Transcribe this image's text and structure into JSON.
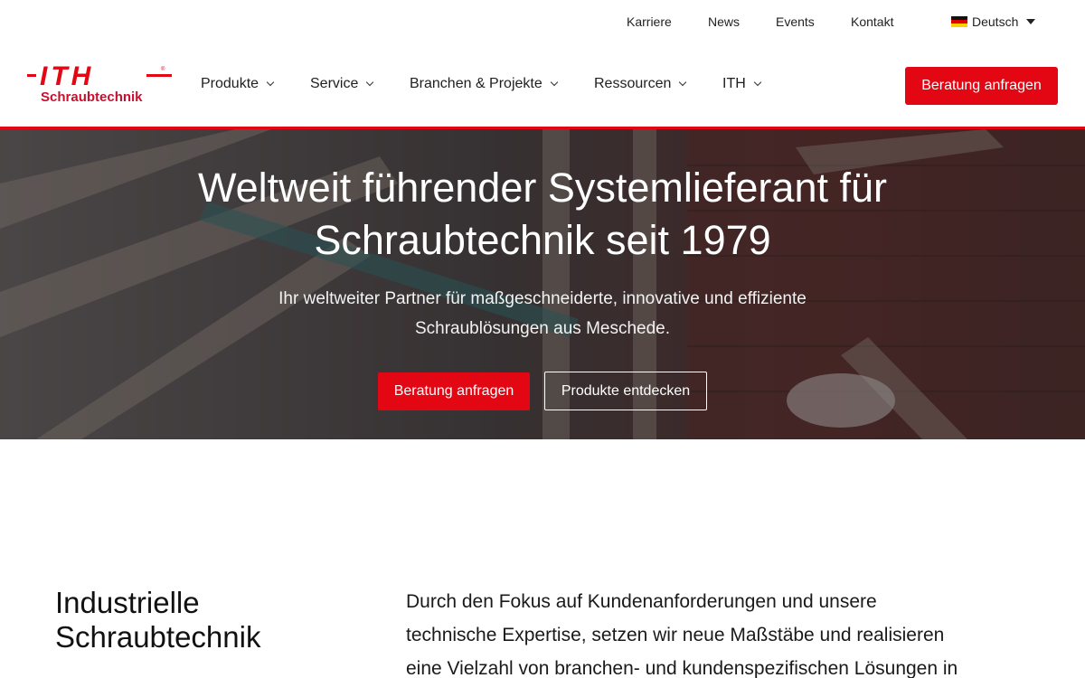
{
  "topbar": {
    "links": [
      "Karriere",
      "News",
      "Events",
      "Kontakt"
    ],
    "language": "Deutsch"
  },
  "header": {
    "logo": {
      "wordmark": "ITH",
      "subtitle": "Schraubtechnik"
    },
    "nav": [
      "Produkte",
      "Service",
      "Branchen & Projekte",
      "Ressourcen",
      "ITH"
    ],
    "cta": "Beratung anfragen"
  },
  "hero": {
    "title_lines": [
      "Weltweit führender Systemlieferant für",
      "Schraubtechnik seit 1979"
    ],
    "subtitle_lines": [
      "Ihr weltweiter Partner für maßgeschneiderte, innovative und effiziente",
      "Schraublösungen aus Meschede."
    ],
    "primary_button": "Beratung anfragen",
    "secondary_button": "Produkte entdecken"
  },
  "intro": {
    "title_lines": [
      "Industrielle",
      "Schraubtechnik"
    ],
    "text_lines": [
      "Durch den Fokus auf Kundenanforderungen und unsere",
      "technische Expertise, setzen wir neue Maßstäbe und realisieren",
      "eine Vielzahl von branchen- und kundenspezifischen Lösungen in"
    ]
  },
  "colors": {
    "brand_red": "#e30613",
    "text_dark": "#1a1a1a",
    "hero_overlay": "#2a2224"
  },
  "icons": {
    "language_flag": "germany-flag-icon",
    "language_caret": "caret-down-icon",
    "nav_chevron": "chevron-down-icon"
  }
}
